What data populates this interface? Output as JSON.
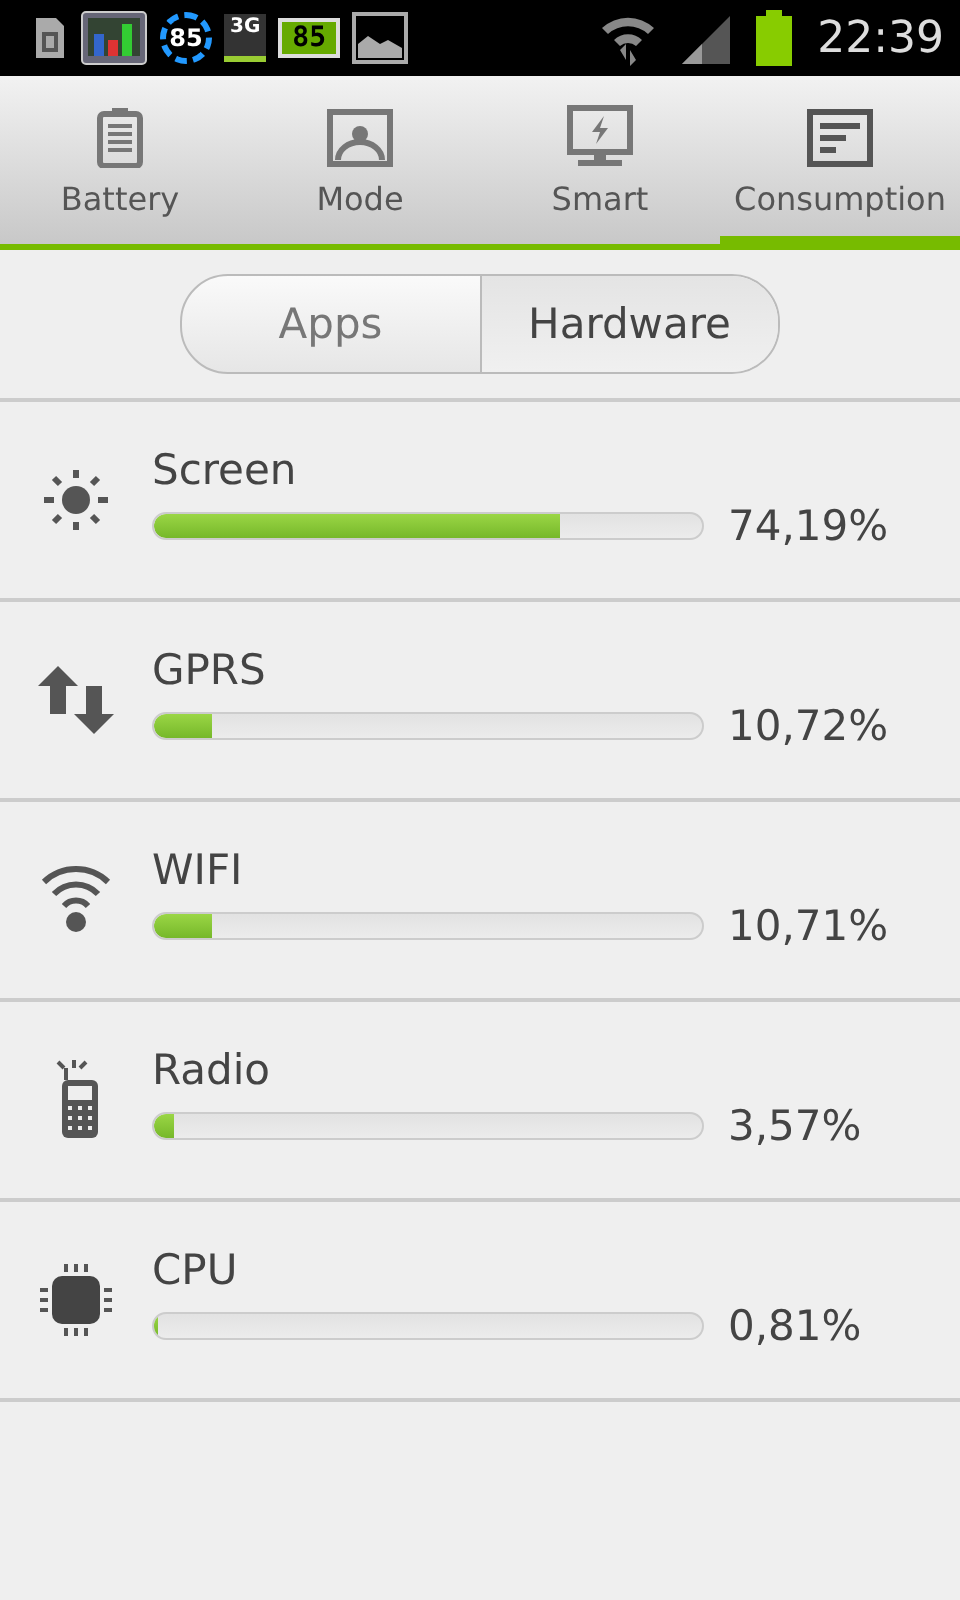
{
  "status_bar": {
    "notifications": [
      {
        "kind": "sim"
      },
      {
        "kind": "chart"
      },
      {
        "kind": "ring",
        "text": "85"
      },
      {
        "kind": "data",
        "text": "3G"
      },
      {
        "kind": "battery",
        "text": "85"
      },
      {
        "kind": "image"
      }
    ],
    "time": "22:39"
  },
  "tabs": [
    {
      "label": "Battery",
      "kind": "battery",
      "selected": false
    },
    {
      "label": "Mode",
      "kind": "mode",
      "selected": false
    },
    {
      "label": "Smart",
      "kind": "smart",
      "selected": false
    },
    {
      "label": "Consumption",
      "kind": "consumption",
      "selected": true
    }
  ],
  "segments": [
    {
      "label": "Apps",
      "selected": false
    },
    {
      "label": "Hardware",
      "selected": true
    }
  ],
  "items": [
    {
      "name": "Screen",
      "kind": "sun",
      "level": 0.7419,
      "reading": "74,19%"
    },
    {
      "name": "GPRS",
      "kind": "arrows",
      "level": 0.1072,
      "reading": "10,72%"
    },
    {
      "name": "WIFI",
      "kind": "wifi",
      "level": 0.1071,
      "reading": "10,71%"
    },
    {
      "name": "Radio",
      "kind": "phone",
      "level": 0.0357,
      "reading": "3,57%"
    },
    {
      "name": "CPU",
      "kind": "chip",
      "level": 0.0081,
      "reading": "0,81%"
    }
  ]
}
